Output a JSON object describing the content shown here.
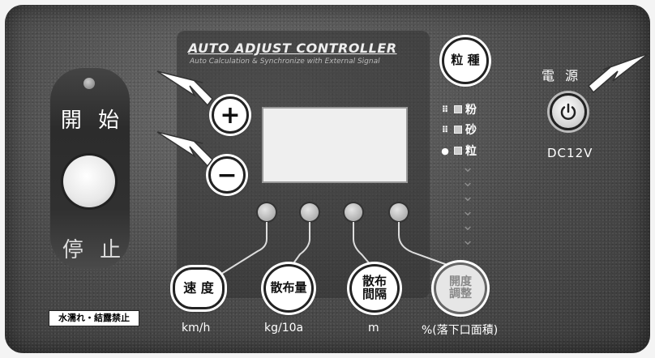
{
  "panel": {
    "title": "AUTO ADJUST CONTROLLER",
    "subtitle": "Auto Calculation & Synchronize with External Signal"
  },
  "left_block": {
    "start_label": "開 始",
    "stop_label": "停 止",
    "warning_label": "水濡れ・結露禁止"
  },
  "adjust_buttons": {
    "plus_symbol": "+",
    "minus_symbol": "−"
  },
  "grain": {
    "button_label": "粒 種",
    "types": [
      {
        "symbol": "⠿",
        "label": "粉"
      },
      {
        "symbol": "⠿",
        "label": "砂"
      },
      {
        "symbol": "●",
        "label": "粒"
      }
    ]
  },
  "function_buttons": [
    {
      "label": "速 度",
      "unit": "km/h"
    },
    {
      "label": "散布量",
      "unit": "kg/10a"
    },
    {
      "label": "散布\n間隔",
      "unit": "m"
    },
    {
      "label": "開度\n調整",
      "unit": "%(落下口面積)"
    }
  ],
  "power": {
    "label": "電 源",
    "voltage": "DC12V"
  },
  "colors": {
    "panel": "#4a4a4a",
    "button_face": "#ffffff",
    "text": "#ffffff"
  }
}
